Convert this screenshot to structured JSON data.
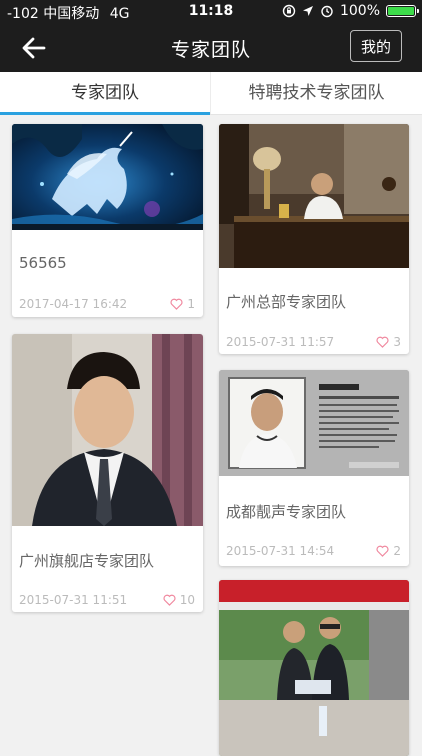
{
  "status_bar": {
    "carrier": "-102 中国移动",
    "network": "4G",
    "time": "11:18",
    "battery_percent": "100%"
  },
  "nav": {
    "title": "专家团队",
    "mine_label": "我的"
  },
  "tabs": [
    {
      "label": "专家团队",
      "active": true
    },
    {
      "label": "特聘技术专家团队",
      "active": false
    }
  ],
  "colors": {
    "accent": "#2aa1e0",
    "heart": "#f08aa0"
  },
  "cards": [
    {
      "name": "56565",
      "date": "2017-04-17 16:42",
      "likes": "1",
      "image": "unicorn-fantasy-image"
    },
    {
      "name": "广州总部专家团队",
      "date": "2015-07-31 11:57",
      "likes": "3",
      "image": "man-at-desk-image"
    },
    {
      "name": "广州旗舰店专家团队",
      "date": "2015-07-31 11:51",
      "likes": "10",
      "image": "man-in-suit-portrait-image"
    },
    {
      "name": "成都靓声专家团队",
      "date": "2015-07-31 14:54",
      "likes": "2",
      "image": "expert-profile-poster-image"
    },
    {
      "name": "",
      "date": "",
      "likes": "",
      "image": "two-men-at-event-image"
    }
  ]
}
